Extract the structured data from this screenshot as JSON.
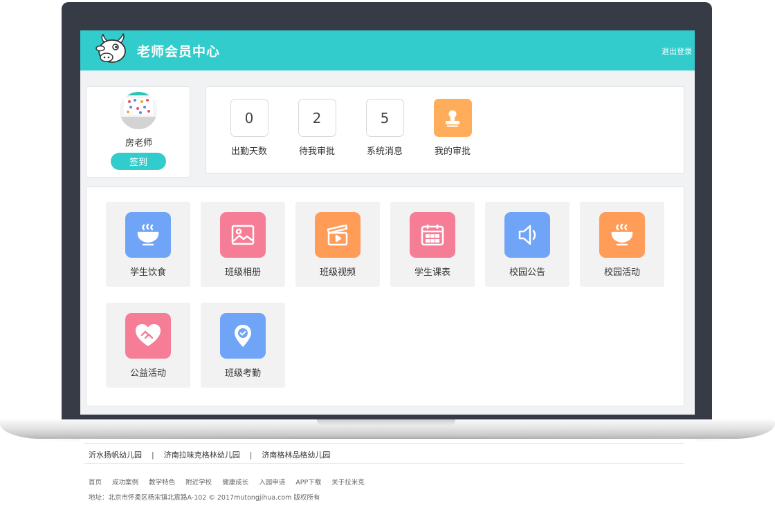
{
  "header": {
    "title": "老师会员中心",
    "logout_label": "退出登录"
  },
  "profile": {
    "name": "房老师",
    "checkin_label": "签到"
  },
  "stats": [
    {
      "value": "0",
      "label": "出勤天数"
    },
    {
      "value": "2",
      "label": "待我审批"
    },
    {
      "value": "5",
      "label": "系统消息"
    },
    {
      "label": "我的审批",
      "icon": "stamp-icon"
    }
  ],
  "modules": [
    {
      "label": "学生饮食",
      "icon": "bowl-icon",
      "color": "#6fa4f7"
    },
    {
      "label": "班级相册",
      "icon": "picture-icon",
      "color": "#f57e96"
    },
    {
      "label": "班级视频",
      "icon": "video-icon",
      "color": "#ff9c57"
    },
    {
      "label": "学生课表",
      "icon": "calendar-icon",
      "color": "#f57e96"
    },
    {
      "label": "校园公告",
      "icon": "speaker-icon",
      "color": "#6fa4f7"
    },
    {
      "label": "校园活动",
      "icon": "bowl-icon",
      "color": "#ff9c57"
    },
    {
      "label": "公益活动",
      "icon": "heart-hands-icon",
      "color": "#f57e96"
    },
    {
      "label": "班级考勤",
      "icon": "location-check-icon",
      "color": "#6fa4f7"
    }
  ],
  "footer": {
    "kindergartens": [
      "沂水扬帆幼儿园",
      "济南拉味克格林幼儿园",
      "济南格林品格幼儿园"
    ],
    "separator": "|",
    "nav": [
      "首页",
      "成功案例",
      "教学特色",
      "附近学校",
      "健康成长",
      "入园申请",
      "APP下载",
      "关于拉米克"
    ],
    "address": "地址：北京市怀柔区杨宋镇北宸路A-102 © 2017mutongjihua.com 版权所有"
  },
  "colors": {
    "header": "#33cccc",
    "accent": "#33cccc",
    "approval": "#ffad5b"
  }
}
